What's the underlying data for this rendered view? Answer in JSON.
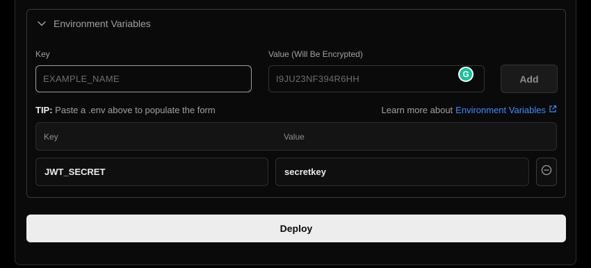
{
  "env_section": {
    "title": "Environment Variables",
    "key_label": "Key",
    "key_placeholder": "EXAMPLE_NAME",
    "value_label": "Value (Will Be Encrypted)",
    "value_placeholder": "I9JU23NF394R6HH",
    "add_label": "Add",
    "tip_prefix": "TIP:",
    "tip_text": " Paste a .env above to populate the form",
    "learn_prefix": "Learn more about",
    "learn_link": "Environment Variables",
    "table_headers": {
      "key": "Key",
      "value": "Value"
    },
    "rows": [
      {
        "key": "JWT_SECRET",
        "value": "secretkey"
      }
    ]
  },
  "grammarly_letter": "G",
  "deploy_label": "Deploy",
  "colors": {
    "accent_link": "#3b8bff",
    "grammarly": "#15c39a",
    "deploy_bg": "#ededed"
  },
  "icons": [
    "chevron-down-icon",
    "external-link-icon",
    "minus-circle-icon",
    "grammarly-icon"
  ]
}
